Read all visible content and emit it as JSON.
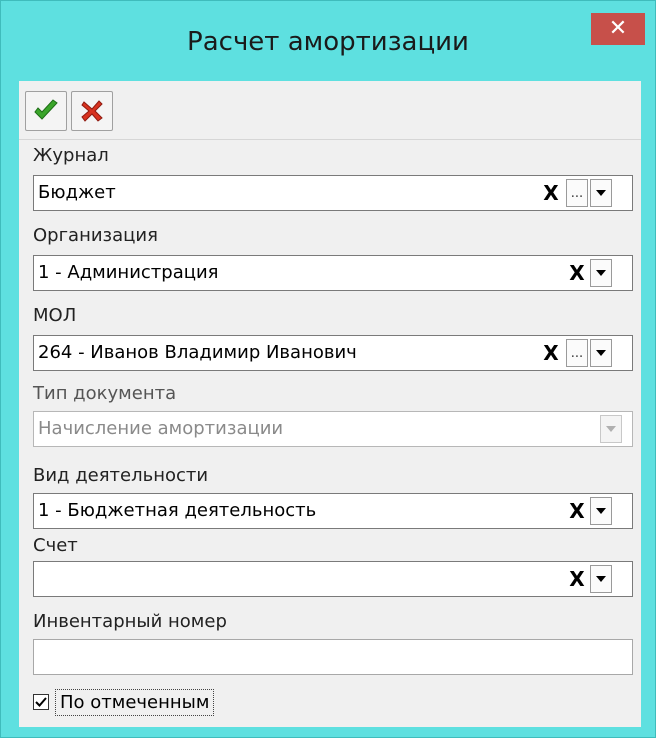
{
  "window": {
    "title": "Расчет амортизации",
    "close_glyph": "✕"
  },
  "toolbar": {
    "ok_icon": "green-checkmark-icon",
    "cancel_icon": "red-cross-icon"
  },
  "fields": {
    "journal": {
      "label": "Журнал",
      "value": "Бюджет"
    },
    "organization": {
      "label": "Организация",
      "value": "1 - Администрация"
    },
    "mol": {
      "label": "МОЛ",
      "value": "264 - Иванов Владимир Иванович"
    },
    "doc_type": {
      "label": "Тип документа",
      "value": "Начисление амортизации"
    },
    "activity": {
      "label": "Вид деятельности",
      "value": "1 - Бюджетная деятельность"
    },
    "account": {
      "label": "Счет",
      "value": ""
    },
    "inventory": {
      "label": "Инвентарный номер",
      "value": ""
    }
  },
  "buttons": {
    "clear_glyph": "X",
    "ellipsis_glyph": "..."
  },
  "checkbox": {
    "label": "По отмеченным",
    "checked": true
  },
  "colors": {
    "window_frame": "#5ee0e0",
    "close_button": "#c7504a",
    "client_bg": "#f0f0f0",
    "ok_icon": "#3aa52a",
    "cancel_icon": "#d8321f"
  }
}
